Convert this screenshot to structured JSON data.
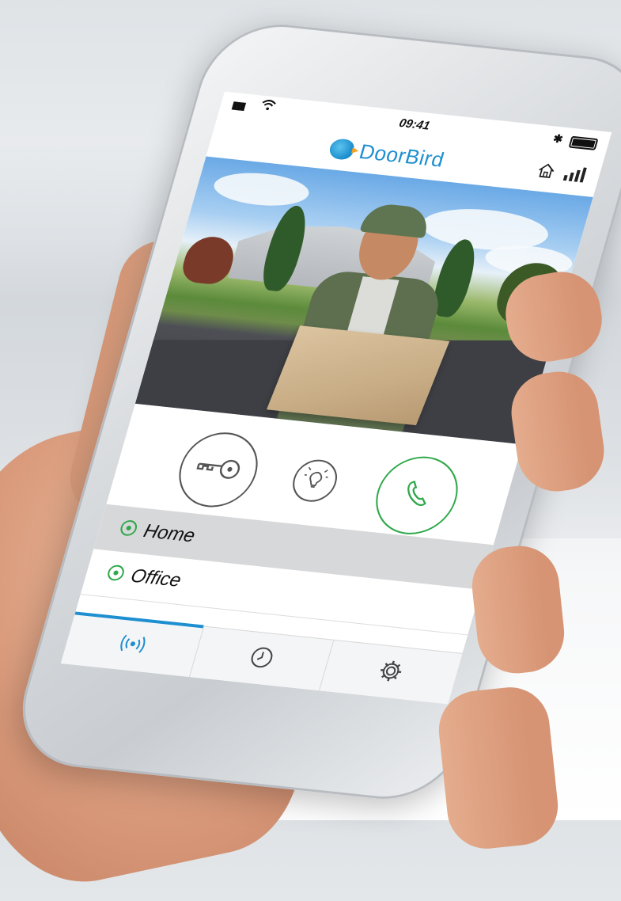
{
  "status_bar": {
    "signal": "▮▮▮",
    "time": "09:41",
    "bluetooth": "✱"
  },
  "app_bar": {
    "logo_text_a": "Door",
    "logo_text_b": "Bird",
    "home_icon": "home-icon",
    "signal_icon": "signal-bars-icon"
  },
  "controls": {
    "door_key_icon": "key-icon",
    "light_icon": "light-bulb-icon",
    "call_icon": "phone-icon"
  },
  "devices": [
    {
      "label": "Home",
      "selected": true
    },
    {
      "label": "Office",
      "selected": false
    }
  ],
  "tabs": [
    {
      "icon": "live-broadcast-icon",
      "active": true
    },
    {
      "icon": "history-clock-icon",
      "active": false
    },
    {
      "icon": "settings-gear-icon",
      "active": false
    }
  ],
  "colors": {
    "brand_blue": "#1e8fd0",
    "call_green": "#2ea84a",
    "selected_row": "#d7d8d9"
  }
}
